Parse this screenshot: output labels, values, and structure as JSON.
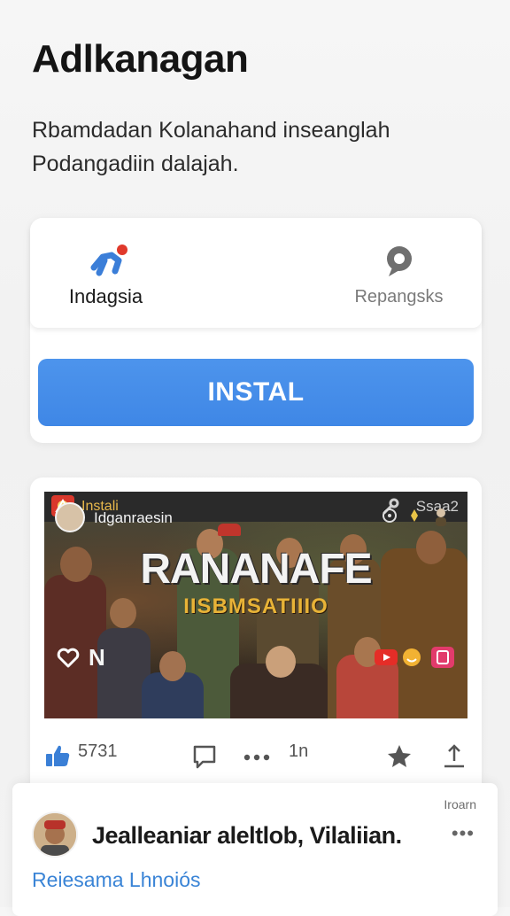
{
  "header": {
    "title": "Adlkanagan",
    "description": "Rbamdadan Kolanahand inseanglah Podangadiin dalajah."
  },
  "install_card": {
    "options": [
      {
        "label": "Indagsia",
        "icon": "running-person-icon"
      },
      {
        "label": "Repangsks",
        "icon": "search-chat-icon"
      }
    ],
    "install_label": "INSTAL"
  },
  "post": {
    "topbar": {
      "app_label": "Instali",
      "right_text": "Ssaa2"
    },
    "channel_name": "Idganraesin",
    "headline": "RANANAFE",
    "subheadline": "IISBMSATIIIO",
    "overlay_icons": [
      "heart-icon",
      "n-letter-icon",
      "youtube-icon",
      "reaction-icon",
      "gallery-icon"
    ],
    "actions": {
      "like_count": "5731",
      "comment_icon": "comment-icon",
      "more_count": "1n",
      "star_icon": "star-icon",
      "share_icon": "share-icon"
    }
  },
  "comment": {
    "meta": "Iroarn",
    "author": "Jealleaniar aleltlob, Vilaliian.",
    "link": "Reiesama Lhnoiós"
  },
  "colors": {
    "accent": "#4a90e8",
    "link": "#3a84d6",
    "badge_red": "#e0392b"
  }
}
